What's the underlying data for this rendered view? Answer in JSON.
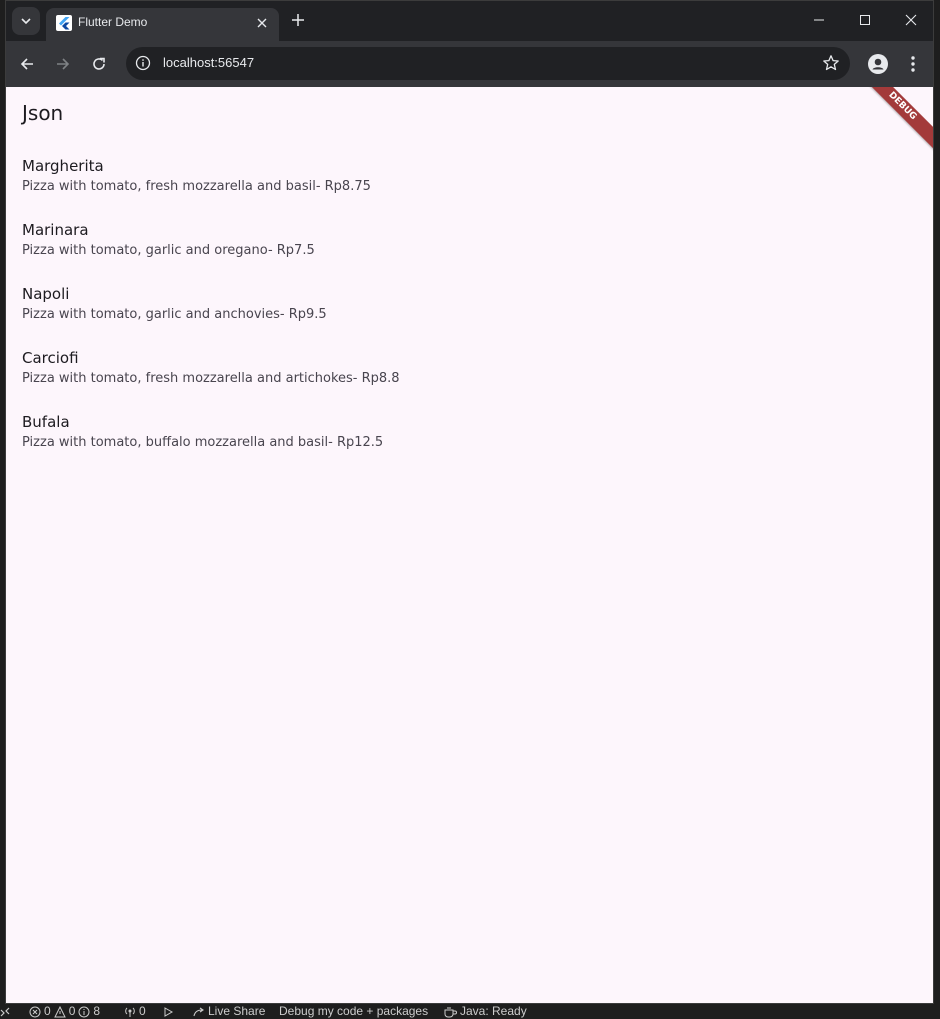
{
  "browser": {
    "tab_title": "Flutter Demo",
    "url": "localhost:56547"
  },
  "app": {
    "title": "Json",
    "debug_label": "DEBUG",
    "items": [
      {
        "title": "Margherita",
        "subtitle": "Pizza with tomato, fresh mozzarella and basil- Rp8.75"
      },
      {
        "title": "Marinara",
        "subtitle": "Pizza with tomato, garlic and oregano- Rp7.5"
      },
      {
        "title": "Napoli",
        "subtitle": "Pizza with tomato, garlic and anchovies- Rp9.5"
      },
      {
        "title": "Carciofi",
        "subtitle": "Pizza with tomato, fresh mozzarella and artichokes- Rp8.8"
      },
      {
        "title": "Bufala",
        "subtitle": "Pizza with tomato, buffalo mozzarella and basil- Rp12.5"
      }
    ]
  },
  "statusbar": {
    "errors": "0",
    "warnings": "0",
    "infos": "8",
    "ports": "0",
    "live_share": "Live Share",
    "debug_mode": "Debug my code + packages",
    "java_status": "Java: Ready"
  }
}
